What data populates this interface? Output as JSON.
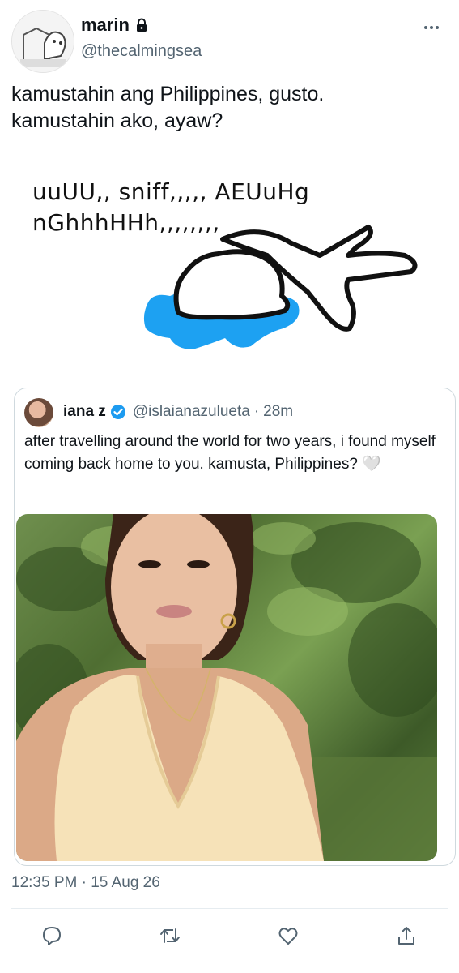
{
  "user": {
    "display_name": "marin",
    "handle": "@thecalmingsea"
  },
  "tweet": {
    "text": "kamustahin ang Philippines, gusto.\nkamustahin ako, ayaw?",
    "drawing_text": "uuUU,, sniff,,,,, AEUuHg\nnGhhhHHh,,,,,,,,",
    "timestamp": "12:35 PM · 15 Aug 26"
  },
  "quote": {
    "display_name": "iana z",
    "handle": "@islaianazulueta",
    "separator": "·",
    "time": "28m",
    "text": "after travelling around the world for two years, i found myself coming back home to you. kamusta, Philippines? 🤍"
  },
  "icons": {
    "lock": "lock-icon",
    "more": "more-icon",
    "verified": "verified-icon",
    "reply": "reply-icon",
    "retweet": "retweet-icon",
    "like": "like-icon",
    "share": "share-icon"
  },
  "colors": {
    "text": "#0f1419",
    "secondary": "#536471",
    "verified": "#1d9bf0",
    "water": "#1da1f2",
    "border": "#cfd9de"
  }
}
